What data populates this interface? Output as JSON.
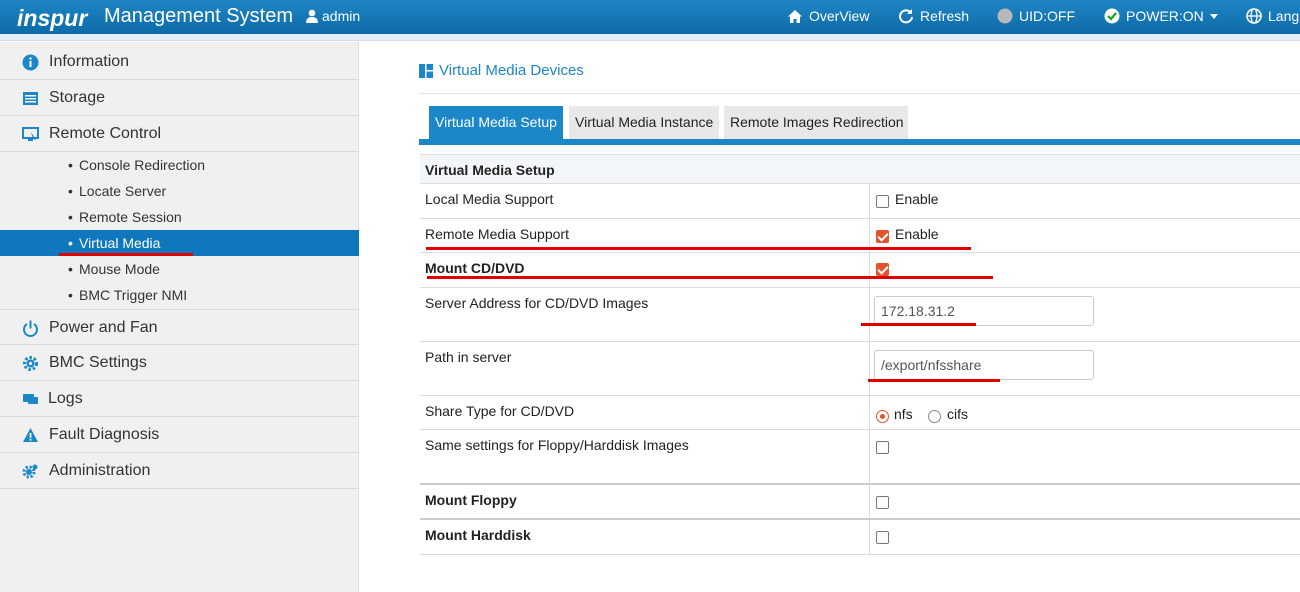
{
  "header": {
    "brand": "inspur",
    "title": "Management System",
    "user": "admin",
    "overview": "OverView",
    "refresh": "Refresh",
    "uid": "UID:OFF",
    "power": "POWER:ON",
    "language": "Lang"
  },
  "sidebar": {
    "items": [
      {
        "label": "Information",
        "icon": "info-icon"
      },
      {
        "label": "Storage",
        "icon": "storage-icon"
      },
      {
        "label": "Remote Control",
        "icon": "monitor-icon"
      },
      {
        "label": "Power and Fan",
        "icon": "power-icon"
      },
      {
        "label": "BMC Settings",
        "icon": "gear-icon"
      },
      {
        "label": "Logs",
        "icon": "chat-icon"
      },
      {
        "label": "Fault Diagnosis",
        "icon": "warning-icon"
      },
      {
        "label": "Administration",
        "icon": "admin-gear-icon"
      }
    ],
    "remote_control_sub": [
      "Console Redirection",
      "Locate Server",
      "Remote Session",
      "Virtual Media",
      "Mouse Mode",
      "BMC Trigger NMI"
    ],
    "active_sub": "Virtual Media"
  },
  "main": {
    "page_title": "Virtual Media Devices",
    "tabs": [
      "Virtual Media Setup",
      "Virtual Media Instance",
      "Remote Images Redirection"
    ],
    "active_tab": "Virtual Media Setup",
    "table_title": "Virtual Media Setup",
    "rows": {
      "local_media": {
        "label": "Local Media Support",
        "option": "Enable",
        "checked": false
      },
      "remote_media": {
        "label": "Remote Media Support",
        "option": "Enable",
        "checked": true
      },
      "mount_cd": {
        "label": "Mount CD/DVD",
        "checked": true
      },
      "server_address": {
        "label": "Server Address for CD/DVD Images",
        "value": "172.18.31.2"
      },
      "path": {
        "label": "Path in server",
        "value": "/export/nfsshare"
      },
      "share_type": {
        "label": "Share Type for CD/DVD",
        "options": [
          "nfs",
          "cifs"
        ],
        "selected": "nfs"
      },
      "same_settings": {
        "label": "Same settings for Floppy/Harddisk Images",
        "checked": false
      },
      "mount_floppy": {
        "label": "Mount Floppy",
        "checked": false
      },
      "mount_harddisk": {
        "label": "Mount Harddisk",
        "checked": false
      }
    }
  },
  "colors": {
    "header_blue": "#0d6aa8",
    "accent_blue": "#1b87c8",
    "active_sidebar": "#0f77be",
    "check_orange": "#e5532d",
    "annotation_red": "#e00000"
  }
}
